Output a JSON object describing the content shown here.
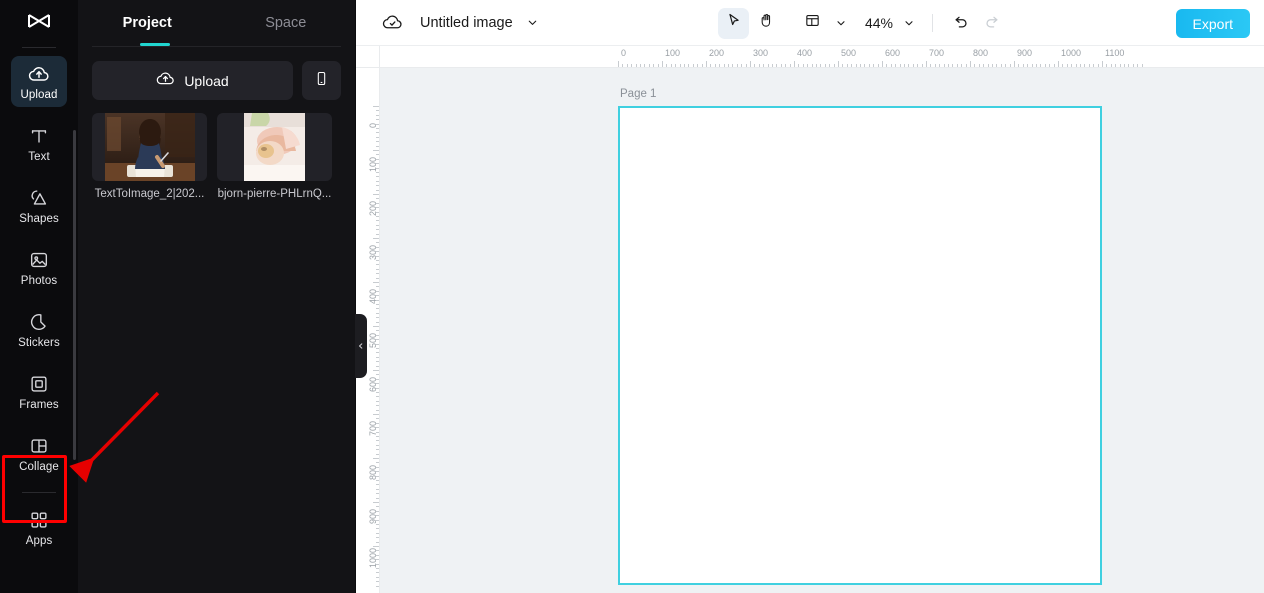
{
  "app": {
    "logo_icon": "capcut-logo-icon",
    "accent_teal": "#21d6d0",
    "accent_blue": "#19b9f0",
    "highlight_red": "#ff0000",
    "canvas_border": "#3fd0e0"
  },
  "rail": {
    "items": [
      {
        "label": "Upload",
        "icon": "cloud-upload-icon",
        "active": true
      },
      {
        "label": "Text",
        "icon": "text-icon",
        "active": false
      },
      {
        "label": "Shapes",
        "icon": "shapes-icon",
        "active": false
      },
      {
        "label": "Photos",
        "icon": "photo-icon",
        "active": false
      },
      {
        "label": "Stickers",
        "icon": "sticker-icon",
        "active": false
      },
      {
        "label": "Frames",
        "icon": "frame-icon",
        "active": false
      },
      {
        "label": "Collage",
        "icon": "collage-icon",
        "active": false
      },
      {
        "label": "Apps",
        "icon": "apps-grid-icon",
        "active": false
      }
    ]
  },
  "panel": {
    "tabs": [
      {
        "label": "Project",
        "active": true
      },
      {
        "label": "Space",
        "active": false
      }
    ],
    "upload_label": "Upload",
    "upload_icon": "cloud-upload-icon",
    "mobile_icon": "mobile-phone-icon",
    "assets": [
      {
        "name": "TextToImage_2|202...",
        "alt": "girl writing in notebook at desk"
      },
      {
        "name": "bjorn-pierre-PHLrnQ...",
        "alt": "person lying down close-up"
      }
    ]
  },
  "topbar": {
    "cloud_icon": "cloud-saved-icon",
    "title": "Untitled image",
    "title_caret_icon": "chevron-down-icon",
    "tools": [
      {
        "name": "select-tool",
        "icon": "cursor-arrow-icon",
        "active": true
      },
      {
        "name": "hand-tool",
        "icon": "hand-icon",
        "active": false
      }
    ],
    "layout_icon": "layout-panel-icon",
    "layout_caret_icon": "chevron-down-icon",
    "zoom_level": "44%",
    "zoom_caret_icon": "chevron-down-icon",
    "undo_icon": "undo-arrow-icon",
    "redo_icon": "redo-arrow-icon",
    "undo_enabled": true,
    "redo_enabled": false,
    "export_label": "Export"
  },
  "stage": {
    "page_label": "Page 1",
    "ruler_h_labels": [
      "0",
      "100",
      "200",
      "300",
      "400",
      "500",
      "600",
      "700",
      "800",
      "900",
      "1000",
      "1100"
    ],
    "ruler_v_labels": [
      "0",
      "100",
      "200",
      "300",
      "400",
      "500",
      "600",
      "700",
      "800",
      "900",
      "1000"
    ],
    "collapse_icon": "chevron-left-icon"
  },
  "annotation": {
    "arrow_icon": "red-pointer-arrow",
    "target": "Collage",
    "highlight_icon": "red-highlight-box"
  }
}
